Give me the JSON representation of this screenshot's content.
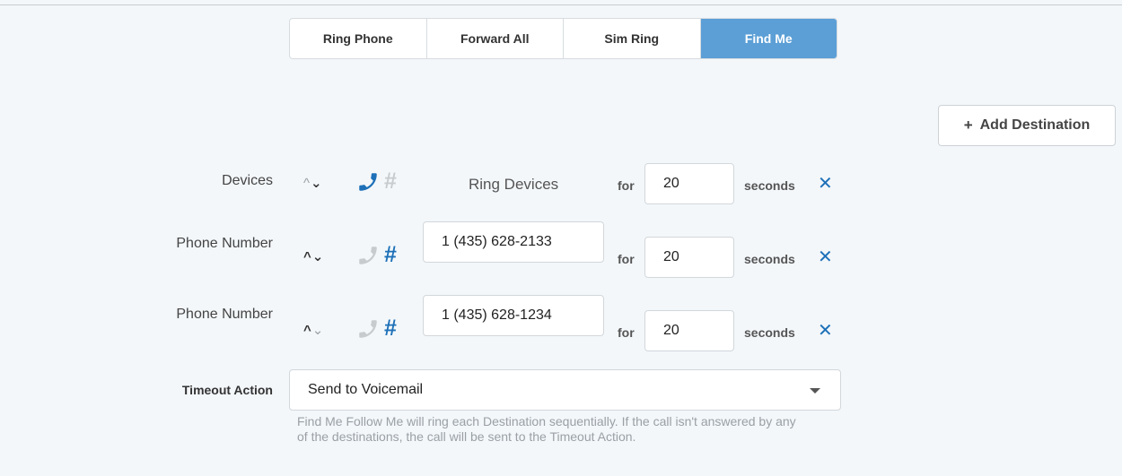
{
  "tabs": [
    {
      "label": "Ring Phone",
      "active": false
    },
    {
      "label": "Forward All",
      "active": false
    },
    {
      "label": "Sim Ring",
      "active": false
    },
    {
      "label": "Find Me",
      "active": true
    }
  ],
  "add_destination": {
    "plus": "+",
    "label": "Add Destination"
  },
  "destinations": [
    {
      "label": "Devices",
      "device_text": "Ring Devices",
      "for_label": "for",
      "seconds": "20",
      "seconds_label": "seconds",
      "remove": "✕",
      "type_active": "phone"
    },
    {
      "label": "Phone Number",
      "number": "1 (435) 628-2133",
      "for_label": "for",
      "seconds": "20",
      "seconds_label": "seconds",
      "remove": "✕",
      "type_active": "hash"
    },
    {
      "label": "Phone Number",
      "number": "1 (435) 628-1234",
      "for_label": "for",
      "seconds": "20",
      "seconds_label": "seconds",
      "remove": "✕",
      "type_active": "hash"
    }
  ],
  "arrows": {
    "up": "^",
    "down": "v"
  },
  "timeout": {
    "label": "Timeout Action",
    "value": "Send to Voicemail",
    "help": "Find Me Follow Me will ring each Destination sequentially. If the call isn't answered by any of the destinations, the call will be sent to the Timeout Action."
  },
  "colors": {
    "accent": "#5b9fd6",
    "icon_active": "#1d70b8",
    "icon_inactive": "#c8cbce"
  },
  "icons": {
    "phone": "phone-icon",
    "hash": "hash-icon",
    "remove": "close-icon",
    "caret": "chevron-down-icon"
  }
}
